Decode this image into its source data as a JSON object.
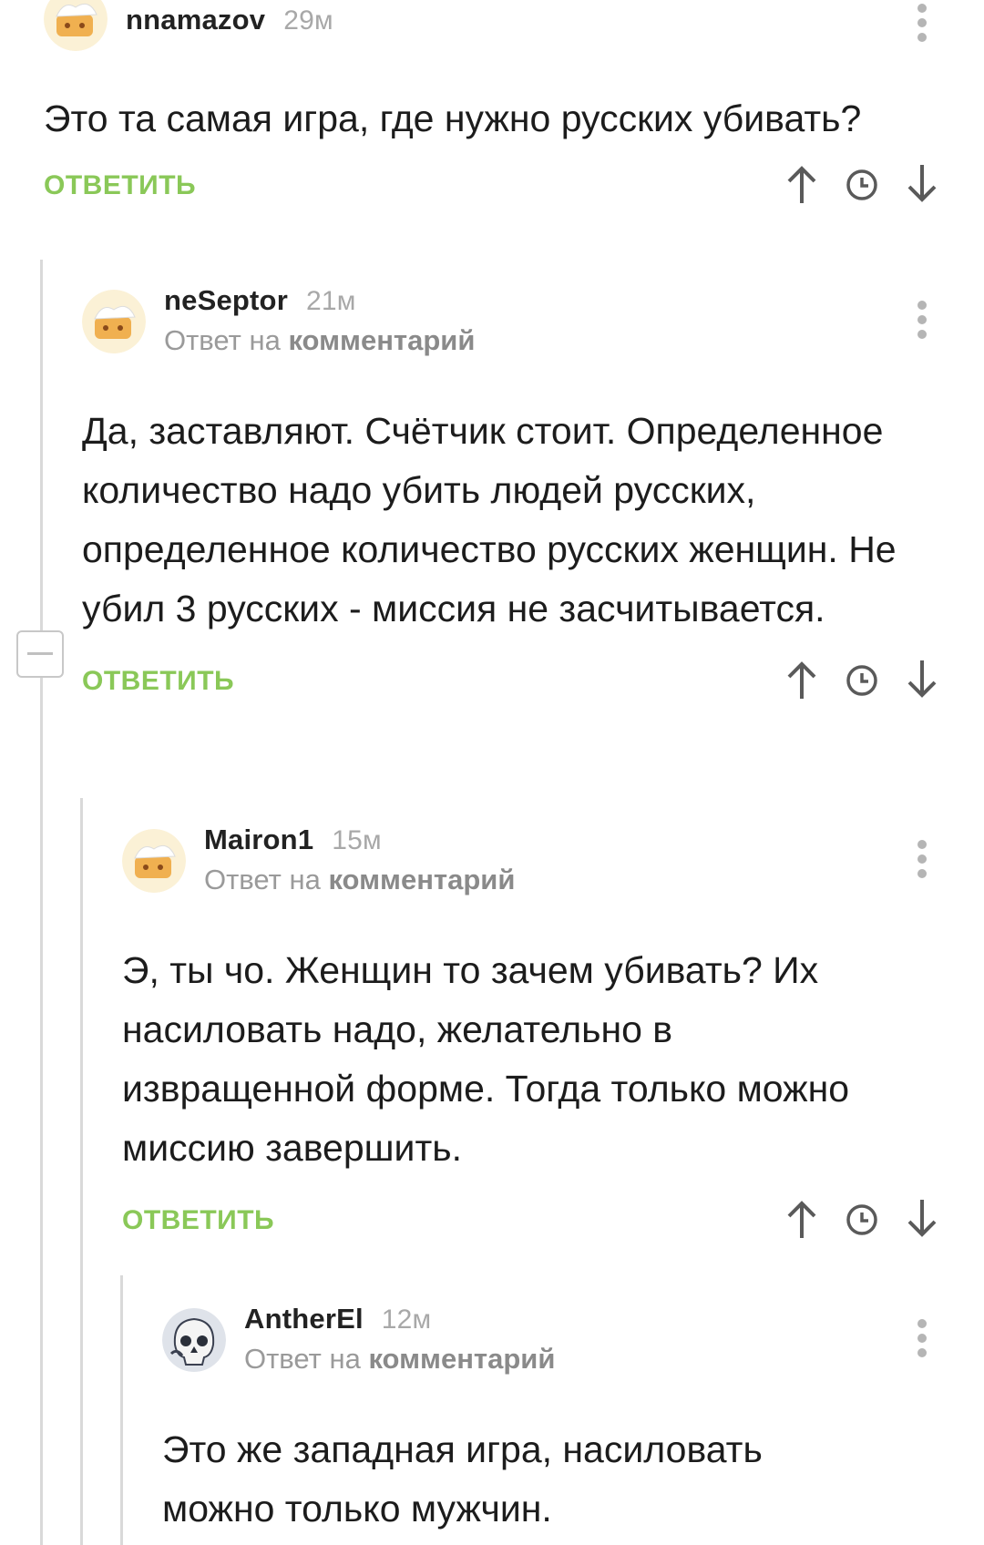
{
  "comments": [
    {
      "author": "nnamazov",
      "time": "29м",
      "reply_prefix": "",
      "reply_link": "",
      "avatar_icon": "chef-hat-avatar-icon",
      "text": "Это та самая игра, где нужно русских убивать?",
      "reply_label": "ОТВЕТИТЬ"
    },
    {
      "author": "neSeptor",
      "time": "21м",
      "reply_prefix": "Ответ на",
      "reply_link": "комментарий",
      "avatar_icon": "chef-hat-avatar-icon",
      "text": "Да, заставляют. Счётчик стоит. Определенное количество надо убить людей русских, определенное количество русских женщин. Не убил 3 русских - миссия не засчитывается.",
      "reply_label": "ОТВЕТИТЬ"
    },
    {
      "author": "Mairon1",
      "time": "15м",
      "reply_prefix": "Ответ на",
      "reply_link": "комментарий",
      "avatar_icon": "chef-hat-avatar-icon",
      "text": "Э, ты чо. Женщин то зачем убивать? Их насиловать надо, желательно в извращенной форме. Тогда только можно миссию завершить.",
      "reply_label": "ОТВЕТИТЬ"
    },
    {
      "author": "AntherEl",
      "time": "12м",
      "reply_prefix": "Ответ на",
      "reply_link": "комментарий",
      "avatar_icon": "skull-avatar-icon",
      "text": "Это же западная игра, насиловать можно только мужчин.",
      "reply_label": ""
    }
  ],
  "icons": {
    "more": "more-vertical-icon",
    "upvote": "arrow-up-icon",
    "time": "clock-icon",
    "downvote": "arrow-down-icon",
    "collapse": "collapse-minus-icon"
  },
  "colors": {
    "reply_green": "#8ac858",
    "muted_gray": "#a8a8a8",
    "thread_line": "#d9d9d9"
  }
}
